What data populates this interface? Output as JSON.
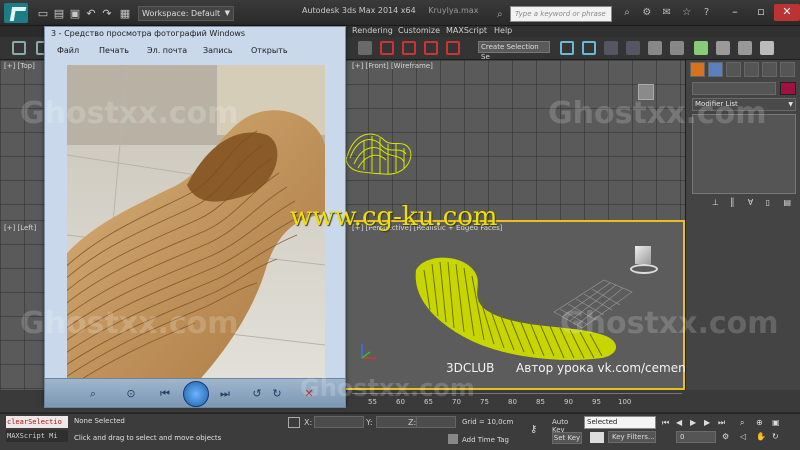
{
  "app": {
    "workspace_label": "Workspace: Default",
    "title": "Autodesk 3ds Max 2014 x64",
    "file": "Kruylya.max",
    "search_placeholder": "Type a keyword or phrase"
  },
  "menubar": {
    "items": [
      "Rendering",
      "Customize",
      "MAXScript",
      "Help"
    ]
  },
  "toolbar": {
    "selection_set_label": "Create Selection Se"
  },
  "viewports": {
    "top_label": "[+] [Top]",
    "front_label": "[+] [Front] [Wireframe]",
    "left_label": "[+] [Left]",
    "persp_label": "[+] [Perspective] [Realistic + Edged Faces]"
  },
  "command_panel": {
    "modifier_list_label": "Modifier List"
  },
  "photo_viewer": {
    "title": "3 - Средство просмотра фотографий Windows",
    "menu": [
      "Файл",
      "Печать",
      "Эл. почта",
      "Запись",
      "Открыть"
    ]
  },
  "timeline": {
    "ticks": [
      "55",
      "60",
      "65",
      "70",
      "75",
      "80",
      "85",
      "90",
      "95",
      "100"
    ]
  },
  "status": {
    "listener_line1": "clearSelectio",
    "listener_line2": "MAXScript Mi",
    "selection_text": "None Selected",
    "prompt_text": "Click and drag to select and move objects",
    "coord_x": "X:",
    "coord_y": "Y:",
    "coord_z": "Z:",
    "grid_text": "Grid = 10,0cm",
    "add_time_tag": "Add Time Tag",
    "auto_key": "Auto Key",
    "set_key": "Set Key",
    "selected_dropdown": "Selected",
    "key_filters": "Key Filters...",
    "frame_value": "0"
  },
  "overlays": {
    "watermark": "Ghostxx.com",
    "site_watermark": "www.cg-ku.com",
    "credit_club": "3DCLUB",
    "credit_author": "Автор урока vk.com/cemen"
  },
  "colors": {
    "viewport_bg": "#5a5a5a",
    "wire_yellow": "#d6e600",
    "object_color_swatch": "#a01040",
    "site_watermark": "#f0e000"
  }
}
